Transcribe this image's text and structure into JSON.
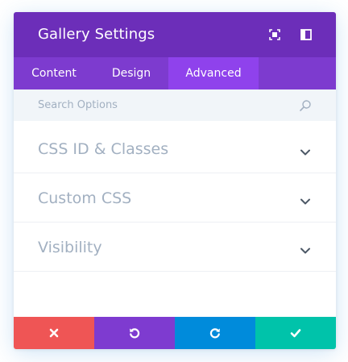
{
  "modal": {
    "title": "Gallery Settings",
    "header_icons": [
      "expand-icon",
      "split-view-icon"
    ]
  },
  "tabs": [
    {
      "label": "Content",
      "active": false
    },
    {
      "label": "Design",
      "active": false
    },
    {
      "label": "Advanced",
      "active": true
    }
  ],
  "search": {
    "placeholder": "Search Options",
    "value": "",
    "icon": "search-icon"
  },
  "sections": [
    {
      "label": "CSS ID & Classes",
      "icon": "chevron-down-icon"
    },
    {
      "label": "Custom CSS",
      "icon": "chevron-down-icon"
    },
    {
      "label": "Visibility",
      "icon": "chevron-down-icon"
    }
  ],
  "footer": {
    "buttons": [
      {
        "action": "discard",
        "icon": "close-icon",
        "color": "#ef5555"
      },
      {
        "action": "undo",
        "icon": "undo-icon",
        "color": "#7e3bd0"
      },
      {
        "action": "redo",
        "icon": "redo-icon",
        "color": "#008bdb"
      },
      {
        "action": "save",
        "icon": "checkmark-icon",
        "color": "#00c3aa"
      }
    ]
  },
  "colors": {
    "header": "#6c2eb9",
    "tab_bar": "#7d3bcf",
    "tab_active": "#8f42ec",
    "search_bg": "#f1f5f9",
    "section_label": "#a2b0c1",
    "chevron": "#4c5866"
  }
}
